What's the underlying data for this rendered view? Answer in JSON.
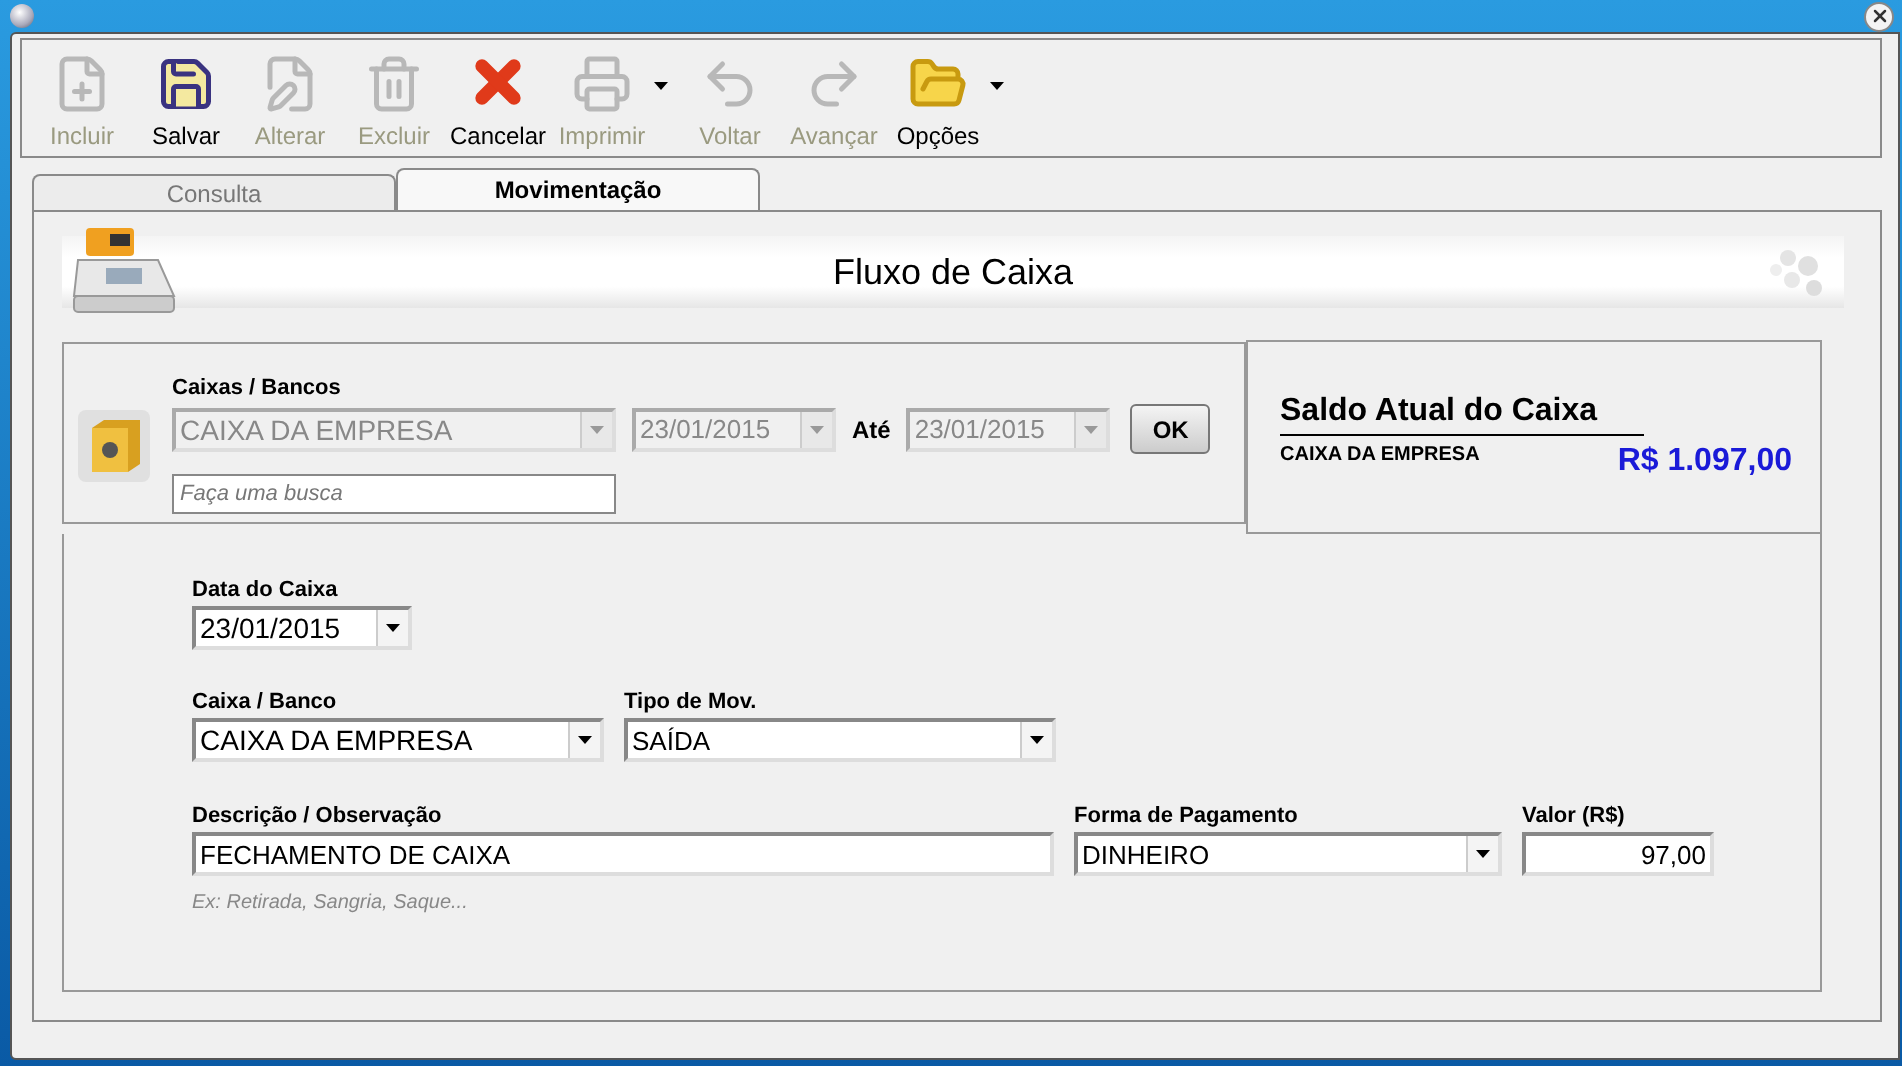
{
  "toolbar": [
    {
      "kind": "new",
      "label": "Incluir",
      "disabled": true,
      "has_menu": false
    },
    {
      "kind": "save",
      "label": "Salvar",
      "disabled": false,
      "has_menu": false
    },
    {
      "kind": "edit",
      "label": "Alterar",
      "disabled": true,
      "has_menu": false
    },
    {
      "kind": "delete",
      "label": "Excluir",
      "disabled": true,
      "has_menu": false
    },
    {
      "kind": "cancel",
      "label": "Cancelar",
      "disabled": false,
      "has_menu": false
    },
    {
      "kind": "print",
      "label": "Imprimir",
      "disabled": true,
      "has_menu": true
    },
    {
      "kind": "back",
      "label": "Voltar",
      "disabled": true,
      "has_menu": false
    },
    {
      "kind": "forward",
      "label": "Avançar",
      "disabled": true,
      "has_menu": false
    },
    {
      "kind": "options",
      "label": "Opções",
      "disabled": false,
      "has_menu": true
    }
  ],
  "tabs": [
    {
      "label": "Consulta",
      "selected": false
    },
    {
      "label": "Movimentação",
      "selected": true
    }
  ],
  "header": {
    "title": "Fluxo de Caixa"
  },
  "filter": {
    "account_label": "Caixas / Bancos",
    "account": {
      "value": "CAIXA DA EMPRESA",
      "disabled": true
    },
    "date_from": {
      "value": "23/01/2015",
      "disabled": true
    },
    "until_label": "Até",
    "date_to": {
      "value": "23/01/2015",
      "disabled": true
    },
    "ok_button": "OK",
    "search": {
      "placeholder": "Faça uma busca"
    }
  },
  "balance": {
    "title": "Saldo Atual do Caixa",
    "account": "CAIXA DA EMPRESA",
    "amount": "R$ 1.097,00"
  },
  "form": {
    "date": {
      "label": "Data do Caixa",
      "value": "23/01/2015",
      "disabled": false
    },
    "account": {
      "label": "Caixa / Banco",
      "value": "CAIXA DA EMPRESA",
      "disabled": false
    },
    "type": {
      "label": "Tipo de Mov.",
      "value": "SAÍDA",
      "disabled": false
    },
    "description": {
      "label": "Descrição / Observação",
      "value": "FECHAMENTO DE CAIXA",
      "hint": "Ex: Retirada, Sangria, Saque..."
    },
    "payment": {
      "label": "Forma de Pagamento",
      "value": "DINHEIRO",
      "disabled": false
    },
    "amount": {
      "label": "Valor (R$)",
      "value": "97,00"
    }
  }
}
